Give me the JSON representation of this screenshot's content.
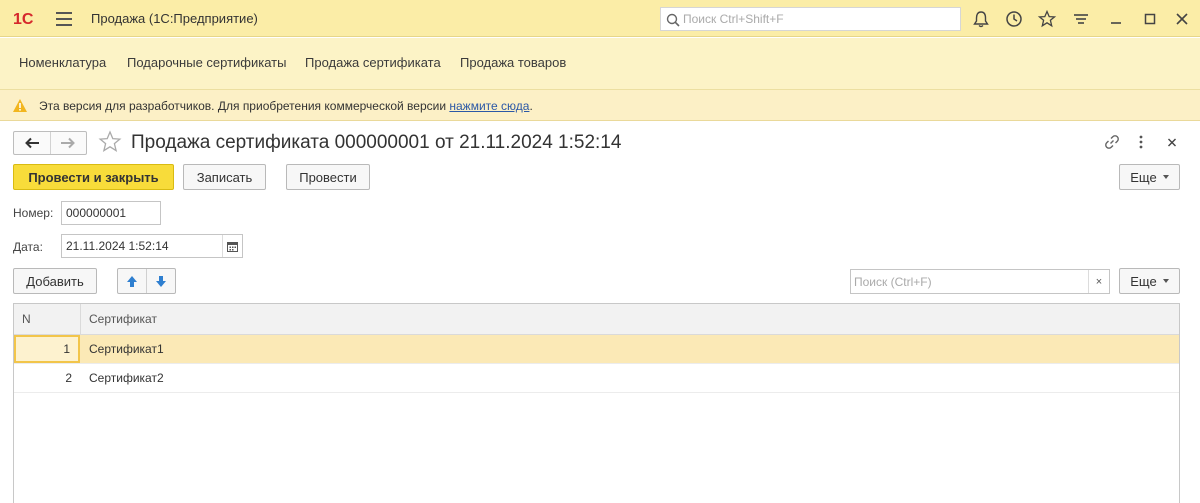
{
  "titlebar": {
    "logo_text": "1С",
    "app_title": "Продажа  (1С:Предприятие)",
    "search_placeholder": "Поиск Ctrl+Shift+F",
    "icons": [
      "bell-icon",
      "history-icon",
      "star-icon",
      "filter-menu-icon",
      "minimize-icon",
      "maximize-icon",
      "close-icon"
    ]
  },
  "sections": [
    {
      "label": "Номенклатура"
    },
    {
      "label": "Подарочные сертификаты"
    },
    {
      "label": "Продажа сертификата"
    },
    {
      "label": "Продажа товаров"
    }
  ],
  "warning": {
    "text": "Эта версия для разработчиков. Для приобретения коммерческой версии ",
    "link": "нажмите сюда",
    "suffix": "."
  },
  "form": {
    "title": "Продажа сертификата 000000001 от 21.11.2024 1:52:14",
    "buttons": {
      "post_close": "Провести и закрыть",
      "save": "Записать",
      "post": "Провести",
      "more": "Еще"
    },
    "number_label": "Номер:",
    "number_value": "000000001",
    "date_label": "Дата:",
    "date_value": "21.11.2024  1:52:14"
  },
  "table_toolbar": {
    "add": "Добавить",
    "search_placeholder": "Поиск (Ctrl+F)",
    "clear": "×",
    "more": "Еще"
  },
  "table": {
    "columns": [
      "N",
      "Сертификат"
    ],
    "rows": [
      {
        "n": "1",
        "name": "Сертификат1",
        "selected": true
      },
      {
        "n": "2",
        "name": "Сертификат2",
        "selected": false
      }
    ]
  },
  "colors": {
    "titlebar_bg": "#fbeda7",
    "sections_bg": "#fcf3c6",
    "primary_button": "#f8dc3a",
    "selected_row": "#fbe9b6",
    "link": "#2b58a6",
    "logo_red": "#d5282c"
  }
}
